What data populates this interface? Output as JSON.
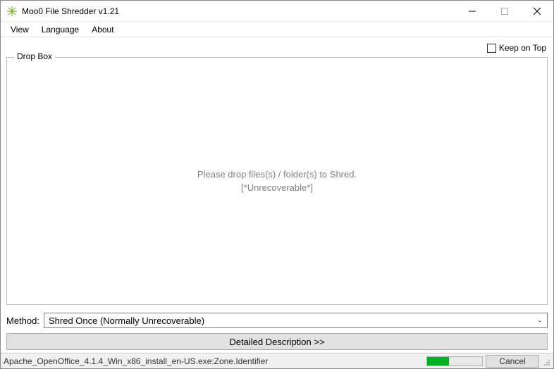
{
  "window": {
    "title": "Moo0 File Shredder v1.21"
  },
  "menu": {
    "view": "View",
    "language": "Language",
    "about": "About"
  },
  "keepOnTop": {
    "label": "Keep on Top",
    "checked": false
  },
  "dropbox": {
    "title": "Drop Box",
    "line1": "Please drop files(s) / folder(s) to Shred.",
    "line2": "[*Unrecoverable*]"
  },
  "method": {
    "label": "Method:",
    "selected": "Shred Once (Normally Unrecoverable)"
  },
  "description": {
    "button": "Detailed Description >>"
  },
  "status": {
    "text": "Apache_OpenOffice_4.1.4_Win_x86_install_en-US.exe:Zone.Identifier",
    "cancel": "Cancel",
    "progressPercent": 40
  }
}
